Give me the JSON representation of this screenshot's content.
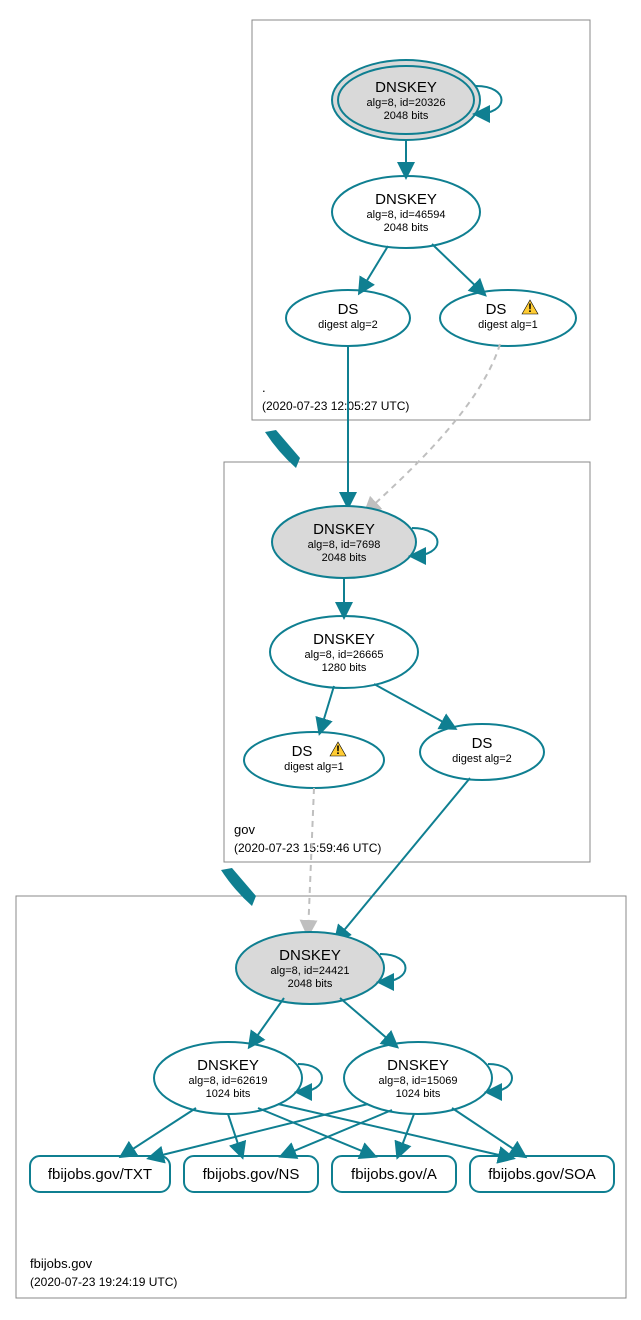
{
  "zones": {
    "root": {
      "label": ".",
      "timestamp": "(2020-07-23 12:05:27 UTC)"
    },
    "gov": {
      "label": "gov",
      "timestamp": "(2020-07-23 15:59:46 UTC)"
    },
    "fbi": {
      "label": "fbijobs.gov",
      "timestamp": "(2020-07-23 19:24:19 UTC)"
    }
  },
  "nodes": {
    "root_ksk": {
      "title": "DNSKEY",
      "sub1": "alg=8, id=20326",
      "sub2": "2048 bits"
    },
    "root_zsk": {
      "title": "DNSKEY",
      "sub1": "alg=8, id=46594",
      "sub2": "2048 bits"
    },
    "root_ds2": {
      "title": "DS",
      "sub1": "digest alg=2"
    },
    "root_ds1": {
      "title": "DS",
      "sub1": "digest alg=1"
    },
    "gov_ksk": {
      "title": "DNSKEY",
      "sub1": "alg=8, id=7698",
      "sub2": "2048 bits"
    },
    "gov_zsk": {
      "title": "DNSKEY",
      "sub1": "alg=8, id=26665",
      "sub2": "1280 bits"
    },
    "gov_ds1": {
      "title": "DS",
      "sub1": "digest alg=1"
    },
    "gov_ds2": {
      "title": "DS",
      "sub1": "digest alg=2"
    },
    "fbi_ksk": {
      "title": "DNSKEY",
      "sub1": "alg=8, id=24421",
      "sub2": "2048 bits"
    },
    "fbi_zsk_a": {
      "title": "DNSKEY",
      "sub1": "alg=8, id=62619",
      "sub2": "1024 bits"
    },
    "fbi_zsk_b": {
      "title": "DNSKEY",
      "sub1": "alg=8, id=15069",
      "sub2": "1024 bits"
    },
    "rr_txt": {
      "label": "fbijobs.gov/TXT"
    },
    "rr_ns": {
      "label": "fbijobs.gov/NS"
    },
    "rr_a": {
      "label": "fbijobs.gov/A"
    },
    "rr_soa": {
      "label": "fbijobs.gov/SOA"
    }
  },
  "icons": {
    "warning": "warning-icon"
  }
}
